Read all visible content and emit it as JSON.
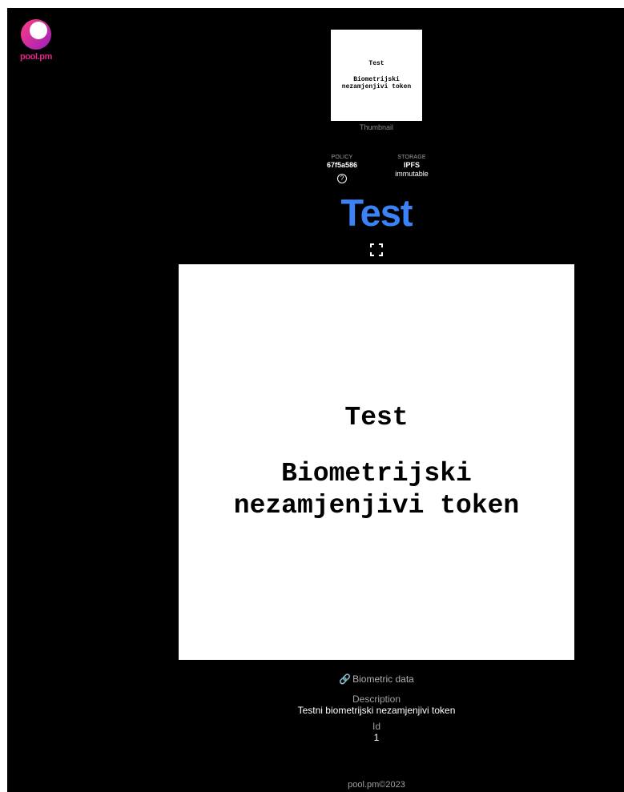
{
  "header": {
    "logo_text": "pool.pm"
  },
  "thumbnail": {
    "image_title": "Test",
    "image_subtitle": "Biometrijski\nnezamjenjivi token",
    "label": "Thumbnail"
  },
  "meta": {
    "policy_label": "POLICY",
    "policy_value": "67f5a586",
    "help_glyph": "?",
    "storage_label": "STORAGE",
    "storage_value": "IPFS",
    "storage_note": "immutable"
  },
  "asset": {
    "title": "Test",
    "image_title": "Test",
    "image_subtitle": "Biometrijski\nnezamjenjivi token",
    "link_icon": "link-icon",
    "link_label": "Biometric data"
  },
  "fields": {
    "description_label": "Description",
    "description_value": "Testni biometrijski nezamjenjivi token",
    "id_label": "Id",
    "id_value": "1"
  },
  "footer": {
    "text": "pool.pm©2023"
  },
  "colors": {
    "background": "#000000",
    "title_blue": "#3b82f6",
    "logo_pink": "#e0278a",
    "logo_magenta": "#c2185b"
  }
}
